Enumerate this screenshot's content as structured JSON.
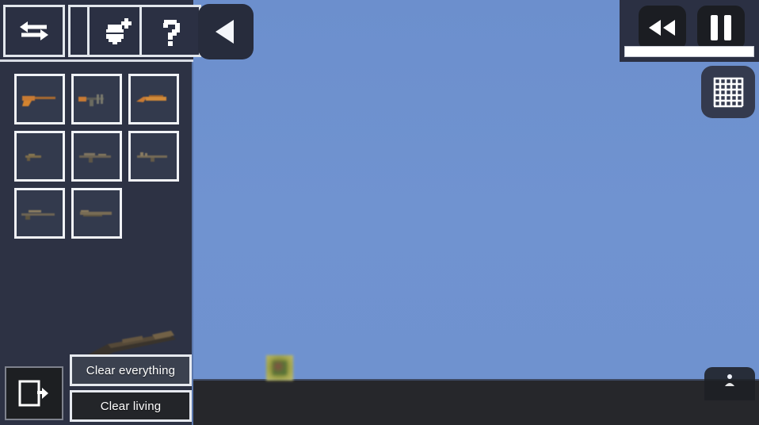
{
  "app": {
    "title": "Sandbox Game Editor",
    "background_sky_color": "#6d90ce",
    "ground_color": "#26272b",
    "sidebar_color": "#2d3244",
    "accent_color": "#e6e9ef"
  },
  "sidebar": {
    "toolbar": [
      {
        "name": "swap-icon",
        "label": "Swap"
      },
      {
        "name": "arrow-right-icon",
        "label": "Next"
      },
      {
        "name": "paint-bucket-icon",
        "label": "Paint"
      },
      {
        "name": "help-icon",
        "label": "?"
      }
    ],
    "weapon_grid": [
      {
        "name": "weapon-pistol",
        "label": "Pistol"
      },
      {
        "name": "weapon-smg",
        "label": "SMG"
      },
      {
        "name": "weapon-sawed-off",
        "label": "Sawed-off Shotgun"
      },
      {
        "name": "weapon-rifle",
        "label": "Rifle"
      },
      {
        "name": "weapon-assault-rifle",
        "label": "Assault Rifle"
      },
      {
        "name": "weapon-carbine",
        "label": "Carbine"
      },
      {
        "name": "weapon-sniper",
        "label": "Sniper"
      },
      {
        "name": "weapon-shotgun",
        "label": "Shotgun"
      }
    ],
    "preview": {
      "name": "weapon-preview",
      "label": "Selected weapon preview"
    },
    "exit_button": {
      "name": "exit-icon",
      "label": "Exit"
    },
    "clear_buttons": [
      {
        "name": "clear-everything-button",
        "label": "Clear everything"
      },
      {
        "name": "clear-living-button",
        "label": "Clear living"
      }
    ]
  },
  "header": {
    "back_button": {
      "name": "back-triangle-icon",
      "label": "Back"
    }
  },
  "playback": {
    "rewind_button": {
      "name": "rewind-icon",
      "label": "Rewind"
    },
    "pause_button": {
      "name": "pause-icon",
      "label": "Pause"
    },
    "slider": {
      "name": "time-slider",
      "value": "100"
    }
  },
  "tools": {
    "grid_toggle": {
      "name": "grid-icon",
      "label": "Toggle grid"
    },
    "bottom_right_button": {
      "name": "spawn-icon",
      "label": "Spawn"
    }
  },
  "scene": {
    "object": {
      "name": "world-crate",
      "label": "Crate"
    }
  }
}
